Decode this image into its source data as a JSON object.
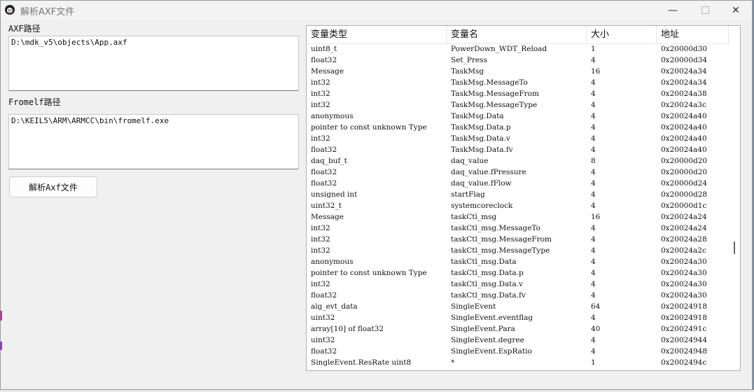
{
  "window": {
    "title": "解析AXF文件",
    "min_glyph": "—",
    "close_glyph": "✕"
  },
  "axf": {
    "label": "AXF路径",
    "value": "D:\\mdk_v5\\objects\\App.axf"
  },
  "fromelf": {
    "label": "Fromelf路径",
    "value": "D:\\KEIL5\\ARM\\ARMCC\\bin\\fromelf.exe"
  },
  "parse_button": "解析Axf文件",
  "table": {
    "headers": [
      "变量类型",
      "变量名",
      "大小",
      "地址"
    ],
    "rows": [
      [
        "uint8_t",
        "PowerDown_WDT_Reload",
        "1",
        "0x20000d30"
      ],
      [
        "float32",
        "Set_Press",
        "4",
        "0x20000d34"
      ],
      [
        "Message",
        "TaskMsg",
        "16",
        "0x20024a34"
      ],
      [
        "int32",
        "TaskMsg.MessageTo",
        "4",
        "0x20024a34"
      ],
      [
        "int32",
        "TaskMsg.MessageFrom",
        "4",
        "0x20024a38"
      ],
      [
        "int32",
        "TaskMsg.MessageType",
        "4",
        "0x20024a3c"
      ],
      [
        "anonymous",
        "TaskMsg.Data",
        "4",
        "0x20024a40"
      ],
      [
        "pointer to const unknown Type",
        "TaskMsg.Data.p",
        "4",
        "0x20024a40"
      ],
      [
        "int32",
        "TaskMsg.Data.v",
        "4",
        "0x20024a40"
      ],
      [
        "float32",
        "TaskMsg.Data.fv",
        "4",
        "0x20024a40"
      ],
      [
        "daq_buf_t",
        "daq_value",
        "8",
        "0x20000d20"
      ],
      [
        "float32",
        "daq_value.fPressure",
        "4",
        "0x20000d20"
      ],
      [
        "float32",
        "daq_value.fFlow",
        "4",
        "0x20000d24"
      ],
      [
        "unsigned int",
        "startFlag",
        "4",
        "0x20000d28"
      ],
      [
        "uint32_t",
        "systemcoreclock",
        "4",
        "0x20000d1c"
      ],
      [
        "Message",
        "taskCtl_msg",
        "16",
        "0x20024a24"
      ],
      [
        "int32",
        "taskCtl_msg.MessageTo",
        "4",
        "0x20024a24"
      ],
      [
        "int32",
        "taskCtl_msg.MessageFrom",
        "4",
        "0x20024a28"
      ],
      [
        "int32",
        "taskCtl_msg.MessageType",
        "4",
        "0x20024a2c"
      ],
      [
        "anonymous",
        "taskCtl_msg.Data",
        "4",
        "0x20024a30"
      ],
      [
        "pointer to const unknown Type",
        "taskCtl_msg.Data.p",
        "4",
        "0x20024a30"
      ],
      [
        "int32",
        "taskCtl_msg.Data.v",
        "4",
        "0x20024a30"
      ],
      [
        "float32",
        "taskCtl_msg.Data.fv",
        "4",
        "0x20024a30"
      ],
      [
        "alg_evt_data",
        "SingleEvent",
        "64",
        "0x20024918"
      ],
      [
        "uint32",
        "SingleEvent.eventflag",
        "4",
        "0x20024918"
      ],
      [
        "array[10] of float32",
        "SingleEvent.Para",
        "40",
        "0x2002491c"
      ],
      [
        "uint32",
        "SingleEvent.degree",
        "4",
        "0x20024944"
      ],
      [
        "float32",
        "SingleEvent.EspRatio",
        "4",
        "0x20024948"
      ],
      [
        "SingleEvent.ResRate uint8",
        "*",
        "1",
        "0x2002494c"
      ]
    ]
  }
}
